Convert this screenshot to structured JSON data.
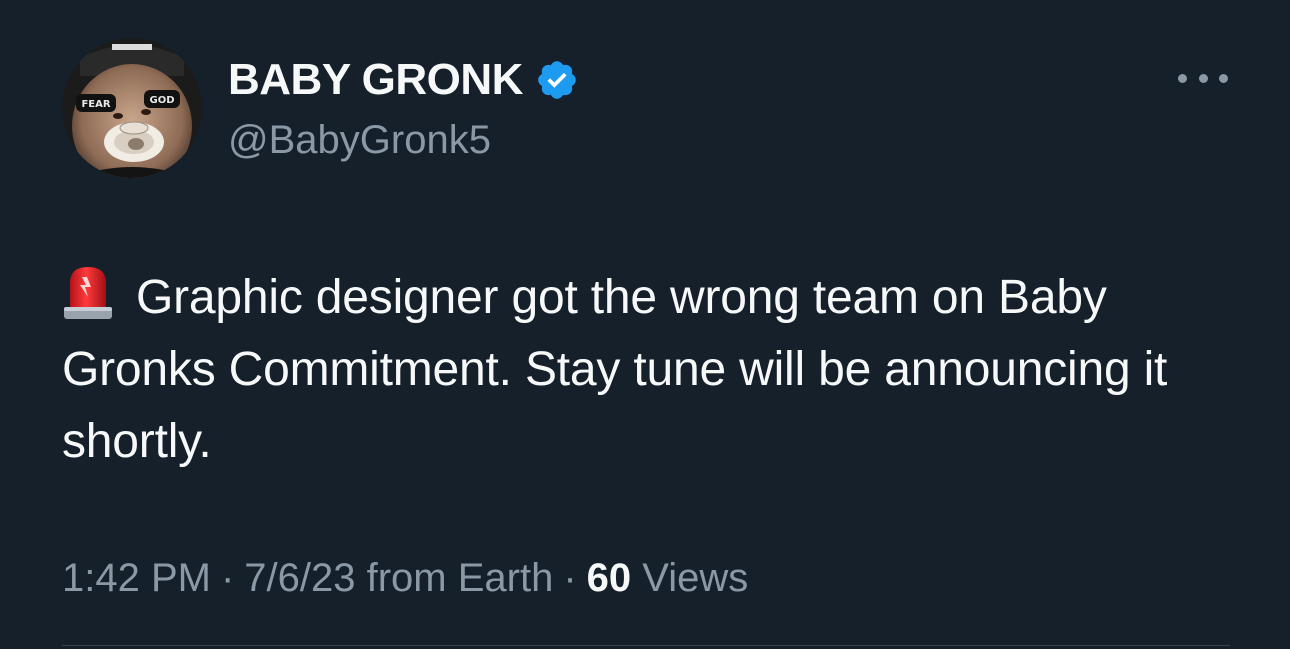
{
  "author": {
    "display_name": "BABY GRONK",
    "handle": "@BabyGronk5",
    "verified": true,
    "avatar_icon": "profile-photo-child-with-pacifier",
    "avatar_eye_black_left": "FEAR",
    "avatar_eye_black_right": "GOD"
  },
  "tweet": {
    "emoji_icon": "police-siren-icon",
    "text": "Graphic designer got the wrong team on Baby Gronks Commitment. Stay tune will be announcing it shortly."
  },
  "meta": {
    "time": "1:42 PM",
    "separator": "·",
    "date_source": "7/6/23 from Earth",
    "views_count": "60",
    "views_label": "Views"
  },
  "colors": {
    "background": "#15202b",
    "primary_text": "#f7f9f9",
    "secondary_text": "#8b98a5",
    "verified_blue": "#1d9bf0",
    "divider": "#38444d"
  }
}
